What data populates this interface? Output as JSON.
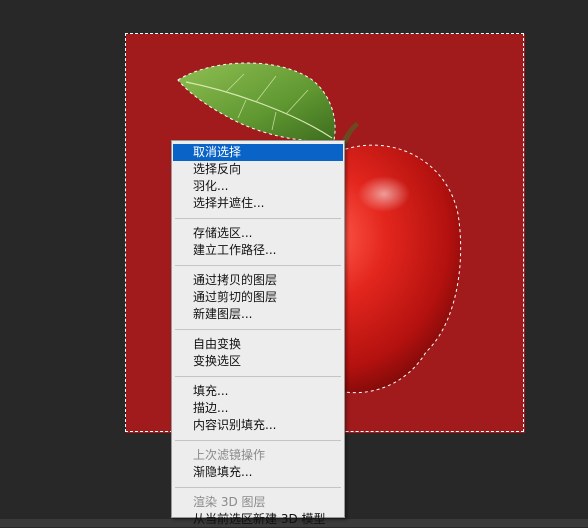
{
  "menu": {
    "groups": [
      {
        "items": [
          {
            "label": "取消选择",
            "state": "selected"
          },
          {
            "label": "选择反向",
            "state": "normal"
          },
          {
            "label": "羽化...",
            "state": "normal"
          },
          {
            "label": "选择并遮住...",
            "state": "normal"
          }
        ]
      },
      {
        "items": [
          {
            "label": "存储选区...",
            "state": "normal"
          },
          {
            "label": "建立工作路径...",
            "state": "normal"
          }
        ]
      },
      {
        "items": [
          {
            "label": "通过拷贝的图层",
            "state": "normal"
          },
          {
            "label": "通过剪切的图层",
            "state": "normal"
          },
          {
            "label": "新建图层...",
            "state": "normal"
          }
        ]
      },
      {
        "items": [
          {
            "label": "自由变换",
            "state": "normal"
          },
          {
            "label": "变换选区",
            "state": "normal"
          }
        ]
      },
      {
        "items": [
          {
            "label": "填充...",
            "state": "normal"
          },
          {
            "label": "描边...",
            "state": "normal"
          },
          {
            "label": "内容识别填充...",
            "state": "normal"
          }
        ]
      },
      {
        "items": [
          {
            "label": "上次滤镜操作",
            "state": "disabled"
          },
          {
            "label": "渐隐填充...",
            "state": "normal"
          }
        ]
      },
      {
        "items": [
          {
            "label": "渲染 3D 图层",
            "state": "disabled"
          },
          {
            "label": "从当前选区新建 3D 模型",
            "state": "normal"
          }
        ]
      }
    ]
  },
  "colors": {
    "workspace": "#282828",
    "canvas_background": "#a11a1c",
    "menu_background": "#ededed",
    "menu_highlight": "#0a64c8"
  },
  "canvas": {
    "subject": "apple-with-leaf",
    "selection": "marching-ants"
  }
}
